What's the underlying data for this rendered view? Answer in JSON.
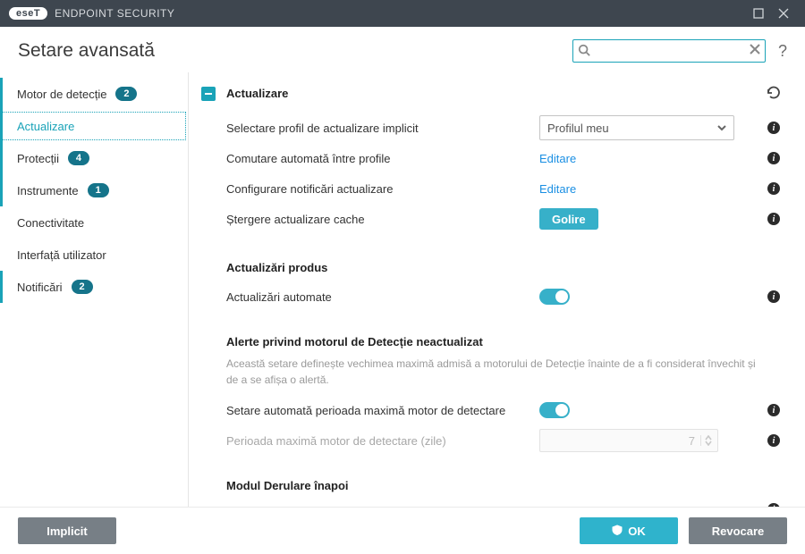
{
  "brand": {
    "pill": "eseT",
    "product": "ENDPOINT SECURITY"
  },
  "page_title": "Setare avansată",
  "help_glyph": "?",
  "sidebar": {
    "items": [
      {
        "label": "Motor de detecție",
        "badge": "2",
        "mark": true,
        "selected": false
      },
      {
        "label": "Actualizare",
        "badge": "",
        "mark": true,
        "selected": true
      },
      {
        "label": "Protecții",
        "badge": "4",
        "mark": true,
        "selected": false
      },
      {
        "label": "Instrumente",
        "badge": "1",
        "mark": true,
        "selected": false
      },
      {
        "label": "Conectivitate",
        "badge": "",
        "mark": false,
        "selected": false
      },
      {
        "label": "Interfață utilizator",
        "badge": "",
        "mark": false,
        "selected": false
      },
      {
        "label": "Notificări",
        "badge": "2",
        "mark": true,
        "selected": false
      }
    ]
  },
  "section": {
    "title": "Actualizare",
    "rows": {
      "profile_label": "Selectare profil de actualizare implicit",
      "profile_value": "Profilul meu",
      "switch_label": "Comutare automată între profile",
      "switch_link": "Editare",
      "notify_label": "Configurare notificări actualizare",
      "notify_link": "Editare",
      "clearcache_label": "Ștergere actualizare cache",
      "clearcache_btn": "Golire"
    }
  },
  "product_updates": {
    "heading": "Actualizări produs",
    "auto_label": "Actualizări automate"
  },
  "alerts": {
    "heading": "Alerte privind motorul de Detecție neactualizat",
    "desc": "Această setare definește vechimea maximă admisă a motorului de Detecție înainte de a fi considerat învechit și de a se afișa o alertă.",
    "auto_max_label": "Setare automată perioada maximă motor de detectare",
    "days_label": "Perioada maximă motor de detectare (zile)",
    "days_value": "7"
  },
  "rollback": {
    "heading": "Modul Derulare înapoi"
  },
  "footer": {
    "default": "Implicit",
    "ok": "OK",
    "cancel": "Revocare"
  }
}
